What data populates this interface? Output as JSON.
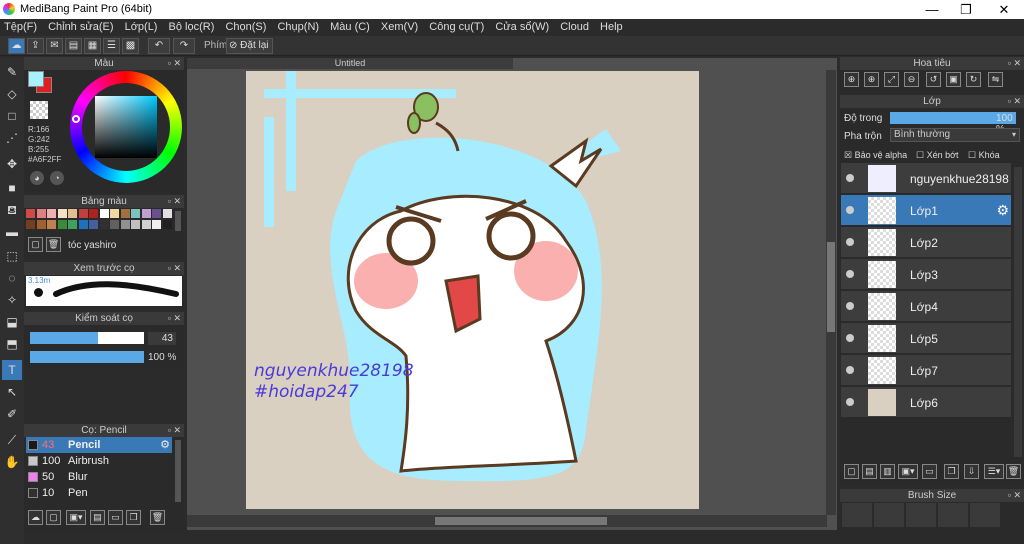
{
  "window": {
    "title": "MediBang Paint Pro (64bit)",
    "minimize": "—",
    "maximize": "❐",
    "close": "✕"
  },
  "menu": [
    "Tệp(F)",
    "Chỉnh sửa(E)",
    "Lớp(L)",
    "Bộ lọc(R)",
    "Chọn(S)",
    "Chụp(N)",
    "Màu (C)",
    "Xem(V)",
    "Công cụ(T)",
    "Cửa sổ(W)",
    "Cloud",
    "Help"
  ],
  "toolbar": {
    "phim_label": "Phím",
    "reset_label": "Đặt lại"
  },
  "color_panel": {
    "title": "Màu",
    "r": "R:166",
    "g": "G:242",
    "b": "B:255",
    "hex": "#A6F2FF",
    "fg": "#A6F2FF",
    "bg": "#E02020"
  },
  "palette_panel": {
    "title": "Bảng màu",
    "colors": [
      "#d04a4a",
      "#e08080",
      "#f0b0b0",
      "#f7e0c8",
      "#e0c090",
      "#c04040",
      "#b02020",
      "#ffffff",
      "#f0d8a0",
      "#a07040",
      "#7cc3c0",
      "#c0a0d0",
      "#6a5090",
      "#e0e0e0",
      "#704020",
      "#a06030",
      "#c08050",
      "#3a8a3a",
      "#40a060",
      "#2070c0",
      "#4060a0",
      "#303030",
      "#606060",
      "#909090",
      "#c0c0c0",
      "#d0d0d0",
      "#f0f0f0",
      "#202020"
    ],
    "preset_name": "tóc yashiro"
  },
  "preview_panel": {
    "title": "Xem trước cọ",
    "size": "3.13m"
  },
  "control_panel": {
    "title": "Kiểm soát cọ",
    "size_value": "43",
    "opacity_value": "100 %",
    "size_fill": 0.6,
    "opacity_fill": 1.0
  },
  "brush_panel": {
    "title": "Cọ: Pencil",
    "items": [
      {
        "size": "43",
        "name": "Pencil",
        "color": "#1a1a1a",
        "selected": true
      },
      {
        "size": "100",
        "name": "Airbrush",
        "color": "#c8c8c8",
        "selected": false
      },
      {
        "size": "50",
        "name": "Blur",
        "color": "#f080f0",
        "selected": false
      },
      {
        "size": "10",
        "name": "Pen",
        "color": "#303030",
        "selected": false
      }
    ]
  },
  "document": {
    "tab": "Untitled",
    "watermark_line1": "nguyenkhue28198",
    "watermark_line2": "#hoidap247"
  },
  "navigator_panel": {
    "title": "Hoa tiêu"
  },
  "layer_panel": {
    "title": "Lớp",
    "opacity_label": "Độ trong",
    "opacity_value": "100 %",
    "opacity_fill": 1.0,
    "blend_label": "Pha trộn",
    "blend_value": "Bình thường",
    "protect_alpha": "Bảo vệ alpha",
    "clipping": "Xén bớt",
    "lock": "Khóa",
    "layers": [
      {
        "name": "nguyenkhue28198",
        "selected": false
      },
      {
        "name": "Lớp1",
        "selected": true
      },
      {
        "name": "Lớp2",
        "selected": false
      },
      {
        "name": "Lớp3",
        "selected": false
      },
      {
        "name": "Lớp4",
        "selected": false
      },
      {
        "name": "Lớp5",
        "selected": false
      },
      {
        "name": "Lớp7",
        "selected": false
      },
      {
        "name": "Lớp6",
        "selected": false
      }
    ]
  },
  "brushsize_panel": {
    "title": "Brush Size"
  }
}
